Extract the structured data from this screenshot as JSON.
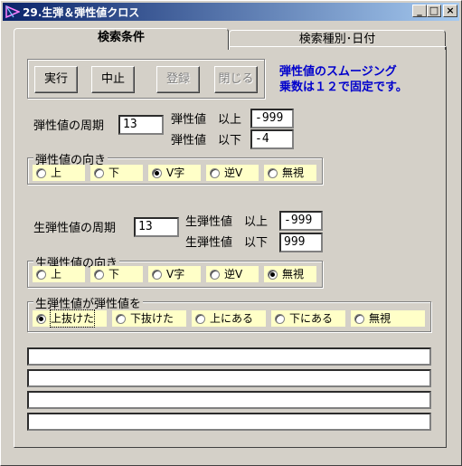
{
  "window": {
    "title": "29.生弾＆弾性値クロス",
    "minimize": "_",
    "maximize": "□",
    "close": "×"
  },
  "tabs": [
    {
      "label": "検索条件",
      "active": true
    },
    {
      "label": "検索種別･日付",
      "active": false
    }
  ],
  "toolbar": {
    "run": "実行",
    "stop": "中止",
    "register": "登録",
    "close": "閉じる"
  },
  "note": {
    "line1": "弾性値のスムージング",
    "line2": "乗数は１２で固定です。"
  },
  "elastic": {
    "period_label": "弾性値の周期",
    "period_value": "13",
    "upper_label": "弾性値　以上",
    "upper_value": "-999",
    "lower_label": "弾性値　以下",
    "lower_value": "-4",
    "direction_legend": "弾性値の向き",
    "directions": [
      "上",
      "下",
      "V字",
      "逆V",
      "無視"
    ],
    "direction_selected": 2
  },
  "raw_elastic": {
    "period_label": "生弾性値の周期",
    "period_value": "13",
    "upper_label": "生弾性値　以上",
    "upper_value": "-999",
    "lower_label": "生弾性値　以下",
    "lower_value": "999",
    "direction_legend": "生弾性値の向き",
    "directions": [
      "上",
      "下",
      "V字",
      "逆V",
      "無視"
    ],
    "direction_selected": 4
  },
  "cross": {
    "legend": "生弾性値が弾性値を",
    "options": [
      "上抜けた",
      "下抜けた",
      "上にある",
      "下にある",
      "無視"
    ],
    "selected": 0
  }
}
